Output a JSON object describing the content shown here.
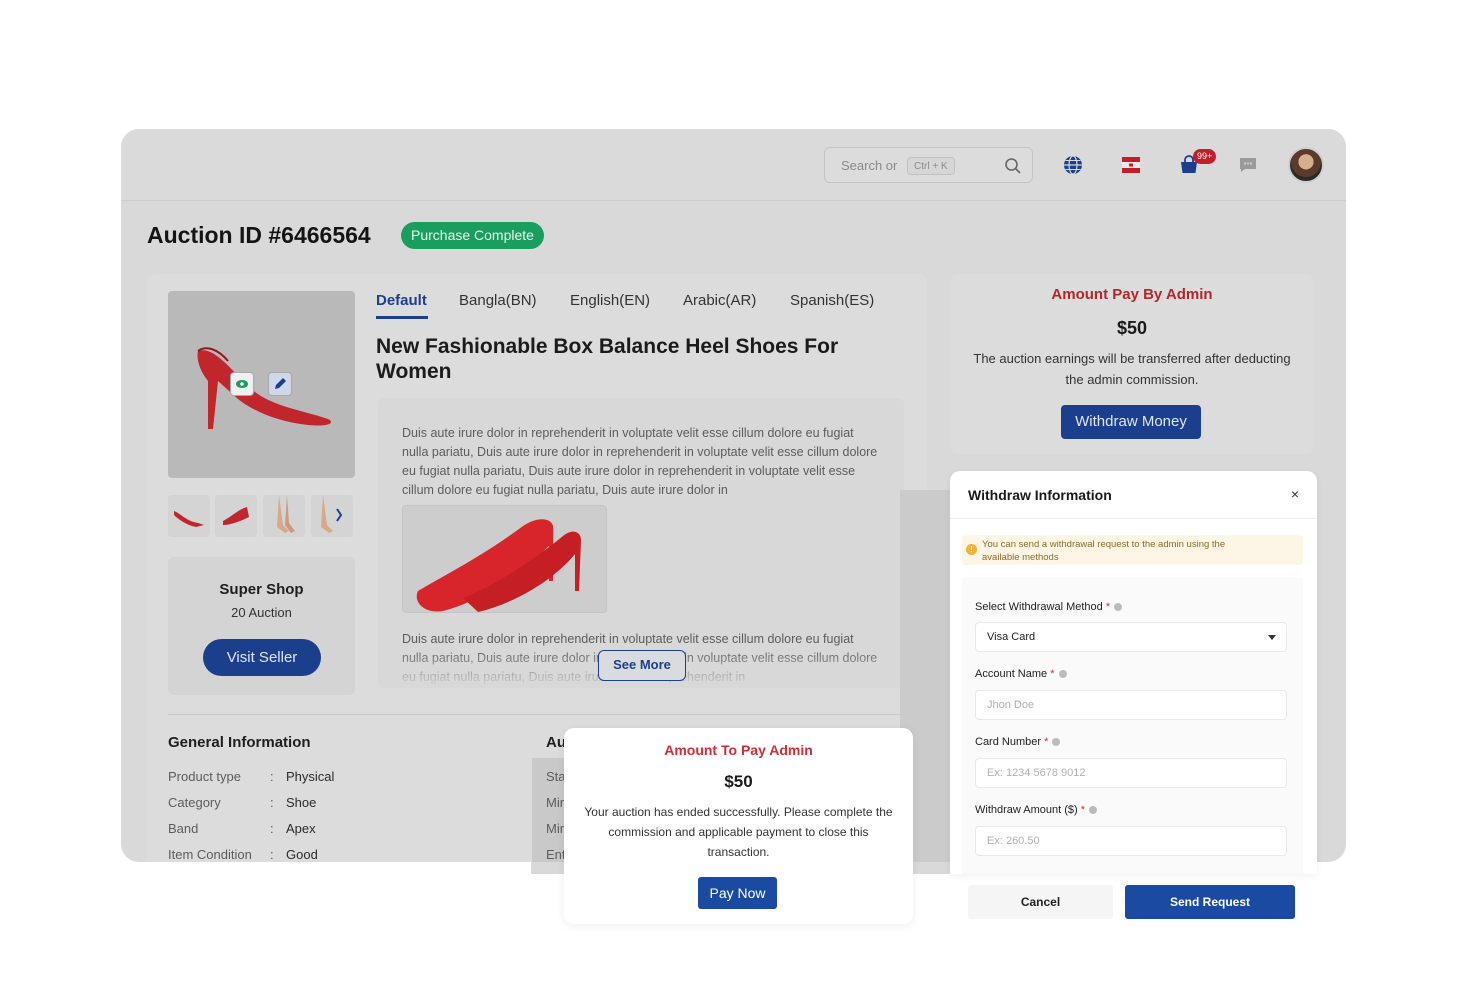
{
  "header": {
    "search_placeholder": "Search or",
    "search_shortcut": "Ctrl + K",
    "notification_count": "99+",
    "icons": [
      "search-icon",
      "globe-icon",
      "flag-icon",
      "cart-icon",
      "chat-icon"
    ]
  },
  "page": {
    "title": "Auction ID #6466564",
    "status": "Purchase Complete"
  },
  "product": {
    "tabs": [
      "Default",
      "Bangla(BN)",
      "English(EN)",
      "Arabic(AR)",
      "Spanish(ES)"
    ],
    "active_tab": "Default",
    "title": "New Fashionable Box Balance Heel Shoes For Women",
    "description_1": "Duis aute irure dolor in reprehenderit in voluptate velit esse cillum dolore eu fugiat nulla pariatu, Duis aute irure dolor in reprehenderit in voluptate velit esse cillum dolore eu fugiat nulla pariatu, Duis aute irure dolor in reprehenderit in voluptate velit esse cillum dolore eu fugiat nulla pariatu, Duis aute irure dolor in",
    "description_2": "Duis aute irure dolor in reprehenderit in voluptate velit esse cillum dolore eu fugiat nulla pariatu, Duis aute irure dolor in reprehenderit in voluptate velit esse cillum dolore eu fugiat nulla pariatu, Duis aute irure dolor in reprehenderit in",
    "see_more": "See More"
  },
  "seller": {
    "name": "Super Shop",
    "auction_count": "20 Auction",
    "visit_label": "Visit Seller"
  },
  "general_info": {
    "title": "General Information",
    "separator": ":",
    "rows": [
      {
        "key": "Product type",
        "value": "Physical"
      },
      {
        "key": "Category",
        "value": "Shoe"
      },
      {
        "key": "Band",
        "value": "Apex"
      },
      {
        "key": "Item Condition",
        "value": "Good"
      }
    ]
  },
  "auction_info": {
    "title_partial": "Au",
    "rows_partial": [
      "Sta",
      "Mir",
      "Mir",
      "Ent"
    ]
  },
  "pay_by_admin": {
    "title": "Amount Pay By Admin",
    "amount": "$50",
    "description": "The auction earnings will be transferred after deducting the admin commission.",
    "button": "Withdraw Money"
  },
  "withdraw_drawer": {
    "title": "Withdraw Information",
    "close": "×",
    "note": "You can send a withdrawal request to the admin using the available methods",
    "method_label": "Select Withdrawal Method",
    "method_value": "Visa Card",
    "account_label": "Account Name",
    "account_placeholder": "Jhon Doe",
    "card_label": "Card Number",
    "card_placeholder": "Ex: 1234 5678 9012",
    "amount_label": "Withdraw Amount ($)",
    "amount_placeholder": "Ex: 260.50",
    "required_mark": "*",
    "cancel": "Cancel",
    "send": "Send Request"
  },
  "pay_admin_modal": {
    "title": "Amount To Pay Admin",
    "amount": "$50",
    "description": "Your auction has ended successfully. Please complete the commission and applicable payment to close this transaction.",
    "button": "Pay Now"
  },
  "colors": {
    "brand_blue": "#1b3f8c",
    "accent_red": "#d12d35",
    "success_green": "#1a9e5f"
  }
}
